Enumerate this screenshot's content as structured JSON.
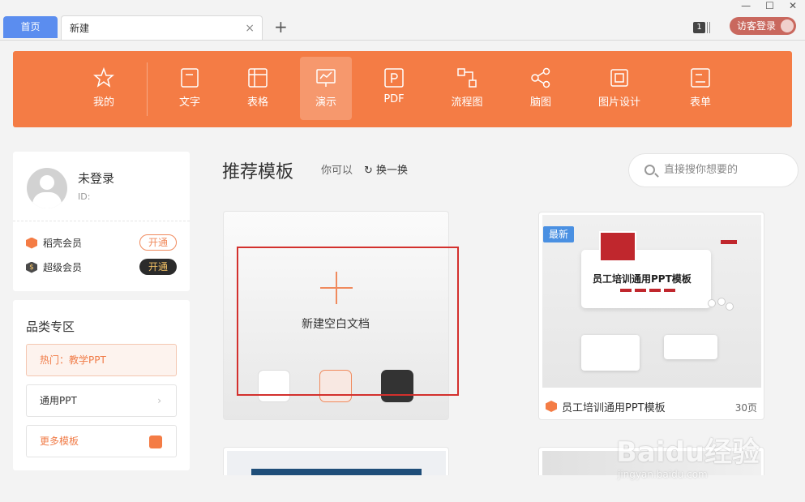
{
  "tabs": {
    "home": "首页",
    "new": "新建",
    "close": "×",
    "add": "+"
  },
  "window": {
    "count_badge": "1",
    "minimize": "—",
    "maximize": "☐",
    "close": "✕",
    "visitor_login": "访客登录"
  },
  "nav": {
    "items": [
      {
        "label": "我的",
        "icon": "star-icon"
      },
      {
        "label": "文字",
        "icon": "document-icon"
      },
      {
        "label": "表格",
        "icon": "table-icon"
      },
      {
        "label": "演示",
        "icon": "presentation-icon",
        "active": true
      },
      {
        "label": "PDF",
        "icon": "pdf-icon"
      },
      {
        "label": "流程图",
        "icon": "flowchart-icon"
      },
      {
        "label": "脑图",
        "icon": "mindmap-icon"
      },
      {
        "label": "图片设计",
        "icon": "image-design-icon"
      },
      {
        "label": "表单",
        "icon": "form-icon"
      }
    ]
  },
  "user": {
    "name": "未登录",
    "id_label": "ID:",
    "member1": {
      "label": "稻壳会员",
      "button": "开通"
    },
    "member2": {
      "label": "超级会员",
      "button": "开通",
      "symbol": "$"
    }
  },
  "category": {
    "title": "品类专区",
    "hot": "热门：教学PPT",
    "general": "通用PPT",
    "more": "更多模板"
  },
  "recommend": {
    "title": "推荐模板",
    "hint": "你可以",
    "swap": "换一换",
    "search_placeholder": "直接搜你想要的"
  },
  "blank": {
    "label": "新建空白文档"
  },
  "template": {
    "badge": "最新",
    "thumb_title": "员工培训通用PPT模板",
    "name": "员工培训通用PPT模板",
    "pages": "30页"
  },
  "watermark": {
    "text": "Baidu经验",
    "url": "jingyan.baidu.com"
  },
  "colors": {
    "accent": "#f47c45",
    "home_tab": "#5b8def",
    "frame": "#d3302d"
  }
}
